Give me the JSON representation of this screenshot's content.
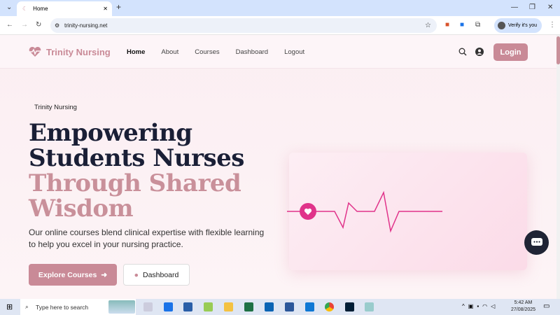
{
  "browser": {
    "tab_title": "Home",
    "url": "trinity-nursing.net",
    "profile_label": "Verify it's you"
  },
  "header": {
    "brand": "Trinity Nursing",
    "nav": [
      "Home",
      "About",
      "Courses",
      "Dashboard",
      "Logout"
    ],
    "login_label": "Login"
  },
  "hero": {
    "eyebrow": "Trinity Nursing",
    "title_dark_1": "Empowering",
    "title_dark_2": "Students Nurses",
    "title_pink_1": "Through Shared",
    "title_pink_2": "Wisdom",
    "description": "Our online courses blend clinical expertise with flexible learning to help you excel in your nursing practice.",
    "primary_cta": "Explore Courses",
    "secondary_cta": "Dashboard"
  },
  "taskbar": {
    "search_placeholder": "Type here to search",
    "time": "5:42 AM",
    "date": "27/08/2025"
  },
  "colors": {
    "accent": "#c98a97",
    "pulse": "#e0338a",
    "dark": "#1a1f36"
  }
}
